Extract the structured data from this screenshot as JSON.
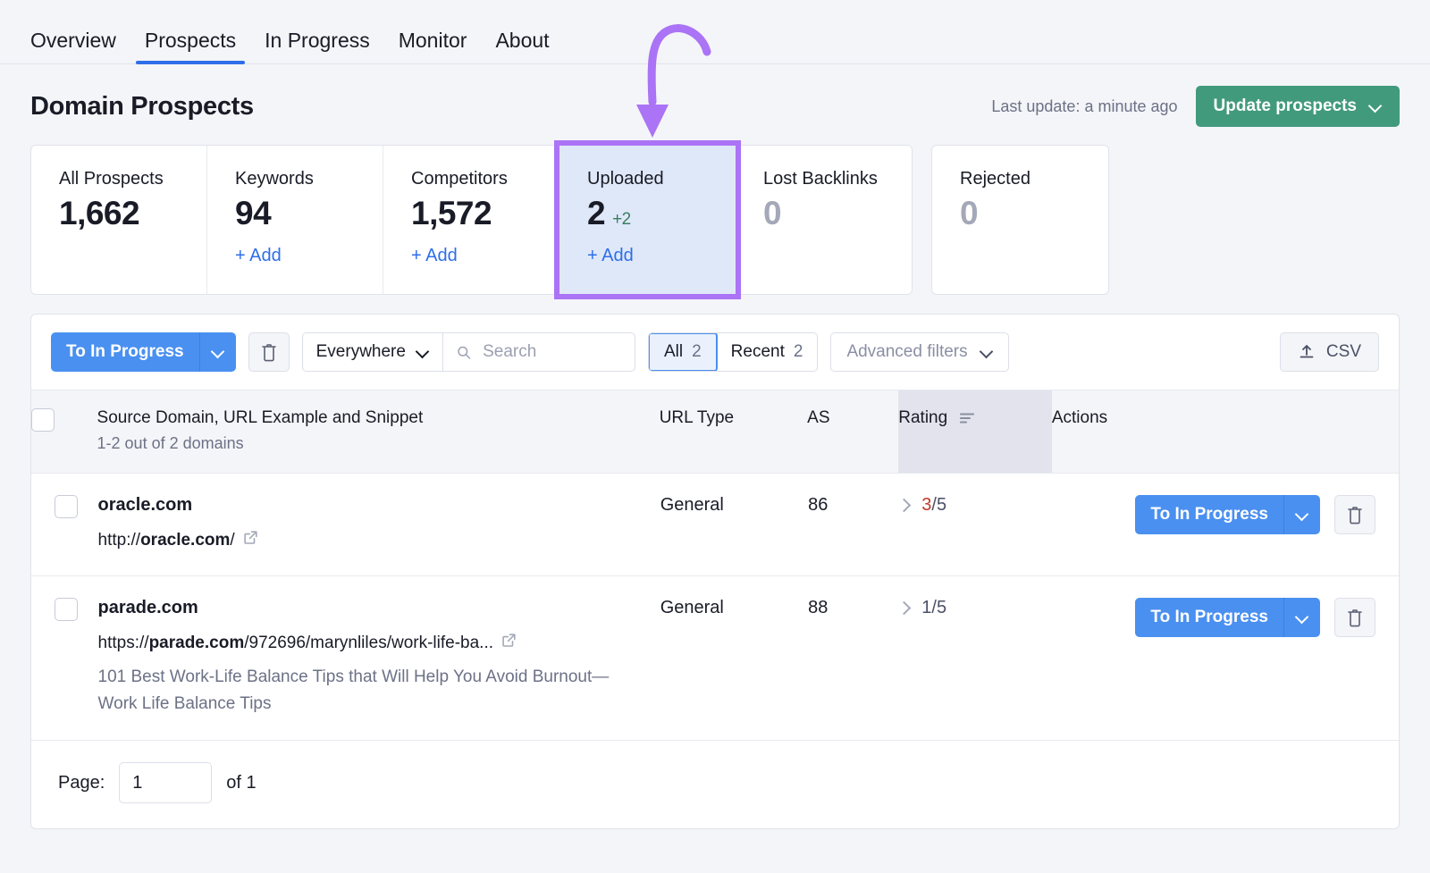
{
  "nav": {
    "tabs": [
      {
        "label": "Overview",
        "active": false
      },
      {
        "label": "Prospects",
        "active": true
      },
      {
        "label": "In Progress",
        "active": false
      },
      {
        "label": "Monitor",
        "active": false
      },
      {
        "label": "About",
        "active": false
      }
    ]
  },
  "header": {
    "title": "Domain Prospects",
    "last_update": "Last update: a minute ago",
    "update_button": "Update prospects"
  },
  "stats": {
    "group1": [
      {
        "label": "All Prospects",
        "value": "1,662",
        "delta": "",
        "add": "",
        "zero": false,
        "highlighted": false
      },
      {
        "label": "Keywords",
        "value": "94",
        "delta": "",
        "add": "+ Add",
        "zero": false,
        "highlighted": false
      },
      {
        "label": "Competitors",
        "value": "1,572",
        "delta": "",
        "add": "+ Add",
        "zero": false,
        "highlighted": false
      },
      {
        "label": "Uploaded",
        "value": "2",
        "delta": "+2",
        "add": "+ Add",
        "zero": false,
        "highlighted": true
      },
      {
        "label": "Lost Backlinks",
        "value": "0",
        "delta": "",
        "add": "",
        "zero": true,
        "highlighted": false
      }
    ],
    "group2": [
      {
        "label": "Rejected",
        "value": "0",
        "delta": "",
        "add": "",
        "zero": true,
        "highlighted": false
      }
    ]
  },
  "toolbar": {
    "bulk_action": "To In Progress",
    "delete_icon": "trash-icon",
    "scope_select": "Everywhere",
    "search_placeholder": "Search",
    "search_value": "",
    "segments": [
      {
        "label": "All",
        "count": "2",
        "active": true
      },
      {
        "label": "Recent",
        "count": "2",
        "active": false
      }
    ],
    "advanced_filters": "Advanced filters",
    "csv": "CSV"
  },
  "table": {
    "columns": {
      "source": "Source Domain, URL Example and Snippet",
      "source_sub": "1-2 out of 2 domains",
      "url_type": "URL Type",
      "as": "AS",
      "rating": "Rating",
      "actions": "Actions"
    },
    "rows": [
      {
        "domain": "oracle.com",
        "url_prefix": "http://",
        "url_domain": "oracle.com",
        "url_suffix": "/",
        "url_truncated": "",
        "snippet": "",
        "url_type": "General",
        "as": "86",
        "rating_score": "3",
        "rating_total": "/5",
        "rating_red": true,
        "action_label": "To In Progress"
      },
      {
        "domain": "parade.com",
        "url_prefix": "https://",
        "url_domain": "parade.com",
        "url_suffix": "/972696/marynliles/work-life-ba...",
        "url_truncated": "",
        "snippet": "101 Best Work-Life Balance Tips that Will Help You Avoid Burnout—Work Life Balance Tips",
        "url_type": "General",
        "as": "88",
        "rating_score": "1",
        "rating_total": "/5",
        "rating_red": false,
        "action_label": "To In Progress"
      }
    ]
  },
  "footer": {
    "page_label": "Page:",
    "page_value": "1",
    "of_label": "of 1"
  },
  "annotation": {
    "type": "curved-arrow",
    "color": "#ab73f5",
    "points_to": "Uploaded"
  },
  "colors": {
    "accent_blue": "#4a90f0",
    "link_blue": "#2e6ee9",
    "green": "#429a7d",
    "highlight_purple": "#ab73f5",
    "highlight_fill": "#dfe8f8",
    "rating_red": "#c0392b"
  }
}
